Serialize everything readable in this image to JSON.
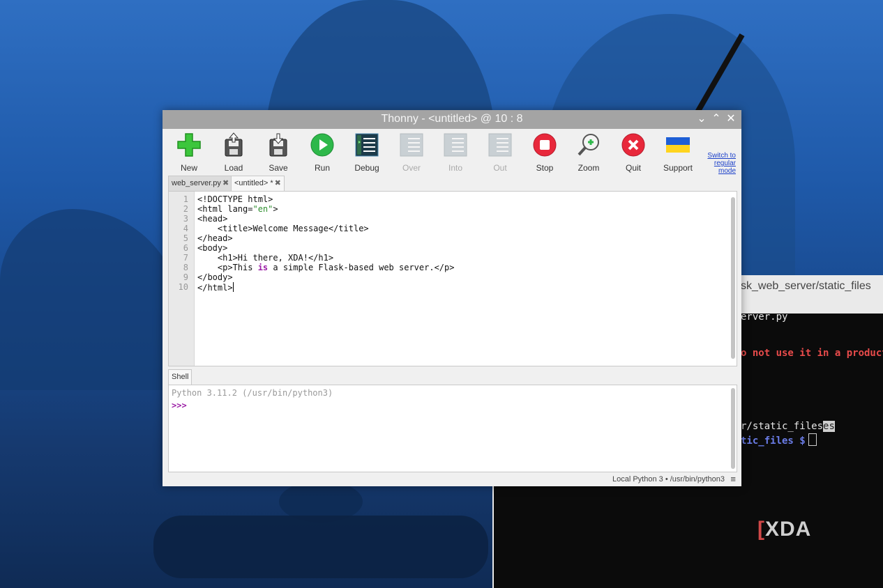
{
  "window": {
    "title": "Thonny  -  <untitled>  @  10 : 8",
    "controls": {
      "minimize": "⌄",
      "maximize": "⌃",
      "close": "✕"
    }
  },
  "toolbar": {
    "items": [
      {
        "label": "New",
        "icon": "plus-icon",
        "enabled": true
      },
      {
        "label": "Load",
        "icon": "load-icon",
        "enabled": true
      },
      {
        "label": "Save",
        "icon": "save-icon",
        "enabled": true
      },
      {
        "label": "Run",
        "icon": "play-icon",
        "enabled": true
      },
      {
        "label": "Debug",
        "icon": "debug-icon",
        "enabled": true
      },
      {
        "label": "Over",
        "icon": "step-over-icon",
        "enabled": false
      },
      {
        "label": "Into",
        "icon": "step-into-icon",
        "enabled": false
      },
      {
        "label": "Out",
        "icon": "step-out-icon",
        "enabled": false
      },
      {
        "label": "Stop",
        "icon": "stop-icon",
        "enabled": true
      },
      {
        "label": "Zoom",
        "icon": "zoom-icon",
        "enabled": true
      },
      {
        "label": "Quit",
        "icon": "quit-icon",
        "enabled": true
      },
      {
        "label": "Support",
        "icon": "ukraine-flag-icon",
        "enabled": true
      }
    ],
    "switch_mode": [
      "Switch to",
      "regular",
      "mode"
    ]
  },
  "editor_tabs": [
    {
      "label": "web_server.py",
      "close": "✖",
      "active": false
    },
    {
      "label": "<untitled> *",
      "close": "✖",
      "active": true
    }
  ],
  "editor": {
    "line_numbers": [
      "1",
      "2",
      "3",
      "4",
      "5",
      "6",
      "7",
      "8",
      "9",
      "10"
    ]
  },
  "shell": {
    "tab": "Shell",
    "version": "Python 3.11.2 (/usr/bin/python3)",
    "prompt": ">>>"
  },
  "statusbar": {
    "interpreter": "Local Python 3  •  /usr/bin/python3",
    "menu": "≡"
  },
  "background_terminal": {
    "title": "sk_web_server/static_files",
    "lines": {
      "l1": "erver.py",
      "l2": "o not use it in a production",
      "l3a": "r/static_files",
      "l3b": "es",
      "l4": "tic_files $"
    }
  },
  "watermark": {
    "bracket": "[",
    "text": "XDA"
  },
  "colors": {
    "run_green": "#2eb84a",
    "stop_red": "#e8283b",
    "keyword_purple": "#9c1ea6",
    "string_green": "#2f8f2f"
  }
}
